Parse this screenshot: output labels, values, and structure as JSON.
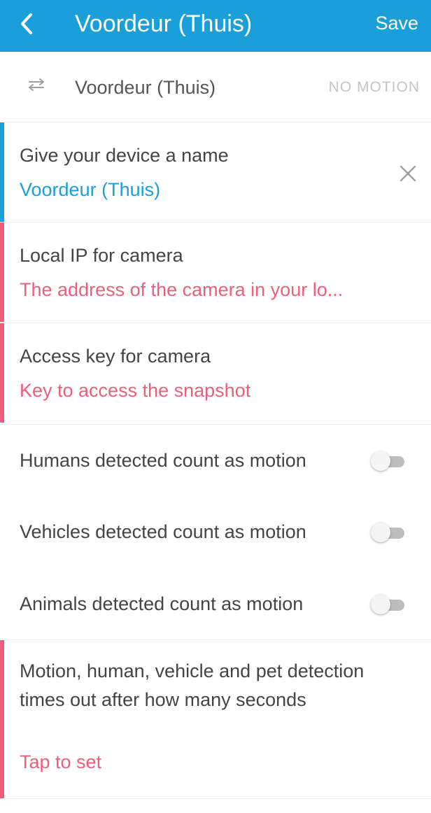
{
  "colors": {
    "appbar": "#1a9fda",
    "valid": "#1a9fda",
    "error": "#ef5d7c",
    "muted": "#c4c4c4"
  },
  "appbar": {
    "back_icon": "chevron-left-icon",
    "title": "Voordeur (Thuis)",
    "save_label": "Save"
  },
  "device_row": {
    "icon": "swap-arrows-icon",
    "name": "Voordeur (Thuis)",
    "state": "NO MOTION"
  },
  "fields": [
    {
      "label": "Give your device a name",
      "value": "Voordeur (Thuis)",
      "status": "valid",
      "clear_icon": "close-icon"
    },
    {
      "label": "Local IP for camera",
      "value": "The address of the camera in your lo...",
      "status": "error"
    },
    {
      "label": "Access key for camera",
      "value": "Key to access the snapshot",
      "status": "error"
    }
  ],
  "toggles": [
    {
      "label": "Humans detected count as motion",
      "on": false
    },
    {
      "label": "Vehicles detected count as motion",
      "on": false
    },
    {
      "label": "Animals detected count as motion",
      "on": false
    }
  ],
  "timeout": {
    "label": "Motion, human, vehicle and pet detection times out after how many seconds",
    "value": "Tap to set",
    "status": "error"
  }
}
